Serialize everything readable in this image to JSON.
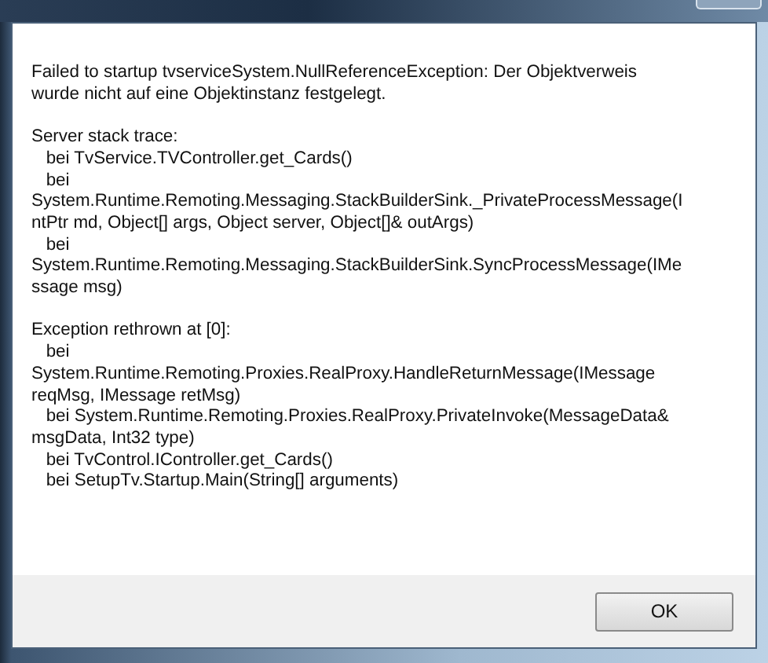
{
  "message": {
    "paragraphs": [
      {
        "lines": [
          "Failed to startup tvserviceSystem.NullReferenceException: Der Objektverweis",
          "wurde nicht auf eine Objektinstanz festgelegt."
        ]
      },
      {
        "lines": [
          "Server stack trace: ",
          "   bei TvService.TVController.get_Cards()",
          "   bei",
          "System.Runtime.Remoting.Messaging.StackBuilderSink._PrivateProcessMessage(I",
          "ntPtr md, Object[] args, Object server, Object[]& outArgs)",
          "   bei",
          "System.Runtime.Remoting.Messaging.StackBuilderSink.SyncProcessMessage(IMe",
          "ssage msg)"
        ]
      },
      {
        "lines": [
          "Exception rethrown at [0]: ",
          "   bei",
          "System.Runtime.Remoting.Proxies.RealProxy.HandleReturnMessage(IMessage",
          "reqMsg, IMessage retMsg)",
          "   bei System.Runtime.Remoting.Proxies.RealProxy.PrivateInvoke(MessageData&",
          "msgData, Int32 type)",
          "   bei TvControl.IController.get_Cards()",
          "   bei SetupTv.Startup.Main(String[] arguments)"
        ]
      }
    ]
  },
  "buttons": [
    {
      "label": "OK"
    }
  ]
}
